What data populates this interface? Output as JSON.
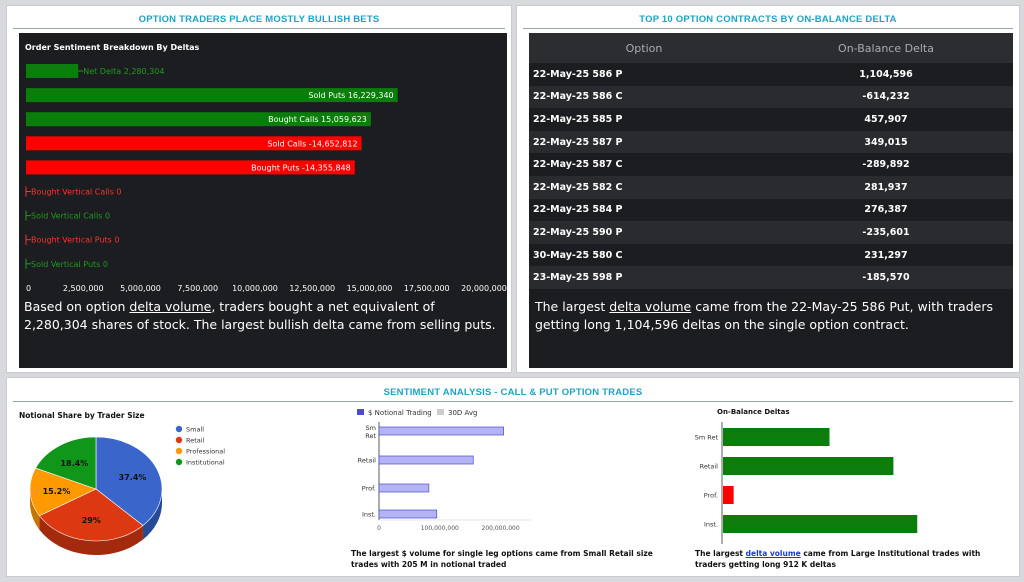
{
  "left_panel": {
    "title": "OPTION TRADERS PLACE MOSTLY BULLISH BETS",
    "chart_title": "Order Sentiment Breakdown By Deltas",
    "summary_pre": "Based on option ",
    "summary_link": "delta volume",
    "summary_post": ", traders bought a net equivalent of 2,280,304 shares of stock. The largest bullish delta came from selling puts."
  },
  "right_panel": {
    "title": "TOP 10 OPTION CONTRACTS BY ON-BALANCE DELTA",
    "col_option": "Option",
    "col_delta": "On-Balance Delta",
    "rows": [
      {
        "option": "22-May-25 586 P",
        "delta": "1,104,596"
      },
      {
        "option": "22-May-25 586 C",
        "delta": "-614,232"
      },
      {
        "option": "22-May-25 585 P",
        "delta": "457,907"
      },
      {
        "option": "22-May-25 587 P",
        "delta": "349,015"
      },
      {
        "option": "22-May-25 587 C",
        "delta": "-289,892"
      },
      {
        "option": "22-May-25 582 C",
        "delta": "281,937"
      },
      {
        "option": "22-May-25 584 P",
        "delta": "276,387"
      },
      {
        "option": "22-May-25 590 P",
        "delta": "-235,601"
      },
      {
        "option": "30-May-25 580 C",
        "delta": "231,297"
      },
      {
        "option": "23-May-25 598 P",
        "delta": "-185,570"
      }
    ],
    "summary_pre": "The largest ",
    "summary_link": "delta volume",
    "summary_post": " came from the 22-May-25 586 Put, with traders getting long 1,104,596 deltas on the single option contract."
  },
  "bottom_panel": {
    "title": "SENTIMENT ANALYSIS - CALL & PUT OPTION TRADES",
    "notional_note": "The largest $ volume for single leg options came from Small Retail size trades with 205 M in notional traded",
    "delta_note_pre": "The largest ",
    "delta_note_link": "delta volume",
    "delta_note_post": " came from Large Institutional trades with traders getting long 912 K deltas"
  },
  "colors": {
    "green": "#0a7d0a",
    "red": "#ff0000",
    "dark_bg": "#1c1d20",
    "accent_title": "#1fa3c4",
    "small": "#3a66cc",
    "retail": "#dc3912",
    "professional": "#ff9900",
    "institutional": "#109618",
    "notional_fill": "#b4b4f5",
    "notional_stroke": "#4b4bd0",
    "avg_gray": "#cccccc"
  },
  "chart_data": [
    {
      "type": "bar",
      "title": "Order Sentiment Breakdown By Deltas",
      "orientation": "horizontal",
      "categories": [
        "Net Delta",
        "Sold Puts",
        "Bought Calls",
        "Sold Calls",
        "Bought Puts",
        "Bought Vertical Calls",
        "Sold Vertical Calls",
        "Bought Vertical Puts",
        "Sold Vertical Puts"
      ],
      "values": [
        2280304,
        16229340,
        15059623,
        -14652812,
        -14355848,
        0,
        0,
        0,
        0
      ],
      "labels": [
        "Net Delta 2,280,304",
        "Sold Puts 16,229,340",
        "Bought Calls 15,059,623",
        "Sold Calls -14,652,812",
        "Bought Puts -14,355,848",
        "Bought Vertical Calls 0",
        "Sold Vertical Calls 0",
        "Bought Vertical Puts 0",
        "Sold Vertical Puts 0"
      ],
      "xlim": [
        0,
        20000000
      ],
      "xticks": [
        "0",
        "2,500,000",
        "5,000,000",
        "7,500,000",
        "10,000,000",
        "12,500,000",
        "15,000,000",
        "17,500,000",
        "20,000,000"
      ]
    },
    {
      "type": "pie",
      "title": "Notional Share by Trader Size",
      "categories": [
        "Small",
        "Retail",
        "Professional",
        "Institutional"
      ],
      "values": [
        37.4,
        29,
        15.2,
        18.4
      ],
      "value_labels": [
        "37.4%",
        "29%",
        "15.2%",
        "18.4%"
      ],
      "legend": "right"
    },
    {
      "type": "bar",
      "orientation": "horizontal",
      "categories": [
        "Sm Ret",
        "Retail",
        "Prof.",
        "Inst."
      ],
      "series": [
        {
          "name": "$ Notional Trading",
          "values": [
            205000000,
            155000000,
            82000000,
            95000000
          ]
        },
        {
          "name": "30D Avg",
          "values": [
            0,
            0,
            0,
            0
          ]
        }
      ],
      "xlim": [
        0,
        250000000
      ],
      "xticks": [
        "0",
        "100,000,000",
        "200,000,000"
      ],
      "legend": "top"
    },
    {
      "type": "bar",
      "title": "On-Balance Deltas",
      "orientation": "horizontal",
      "categories": [
        "Sm Ret",
        "Retail",
        "Prof.",
        "Inst."
      ],
      "values": [
        500000,
        800000,
        50000,
        912000
      ]
    }
  ]
}
